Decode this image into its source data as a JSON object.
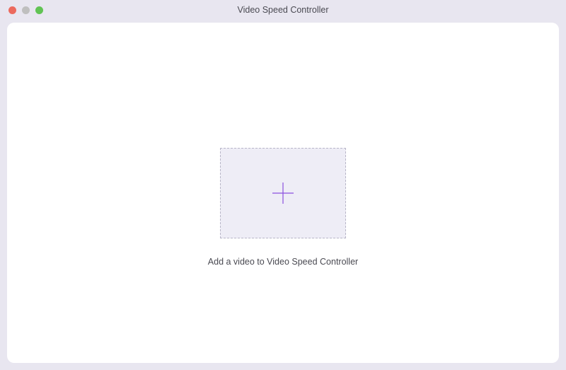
{
  "window": {
    "title": "Video Speed Controller"
  },
  "main": {
    "help_text": "Add a video to Video Speed Controller"
  },
  "colors": {
    "accent": "#7a3fd9"
  }
}
